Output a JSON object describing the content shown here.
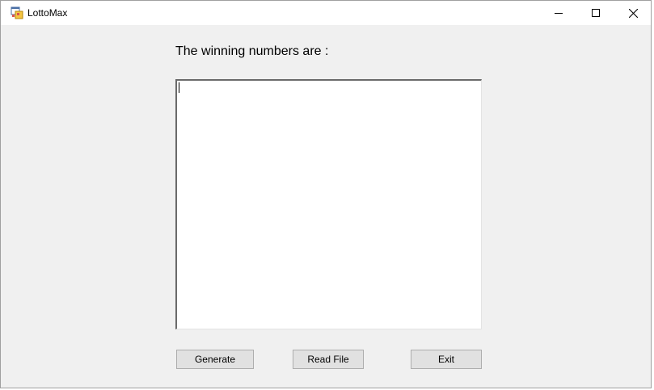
{
  "window": {
    "title": "LottoMax",
    "icon": "app-form-icon",
    "controls": {
      "minimize_icon": "minimize-icon",
      "maximize_icon": "maximize-icon",
      "close_icon": "close-icon"
    }
  },
  "main": {
    "heading": "The winning numbers are :",
    "output_value": ""
  },
  "buttons": {
    "generate": "Generate",
    "read_file": "Read File",
    "exit": "Exit"
  },
  "colors": {
    "form_background": "#f0f0f0",
    "button_face": "#e1e1e1",
    "button_border": "#adadad"
  }
}
